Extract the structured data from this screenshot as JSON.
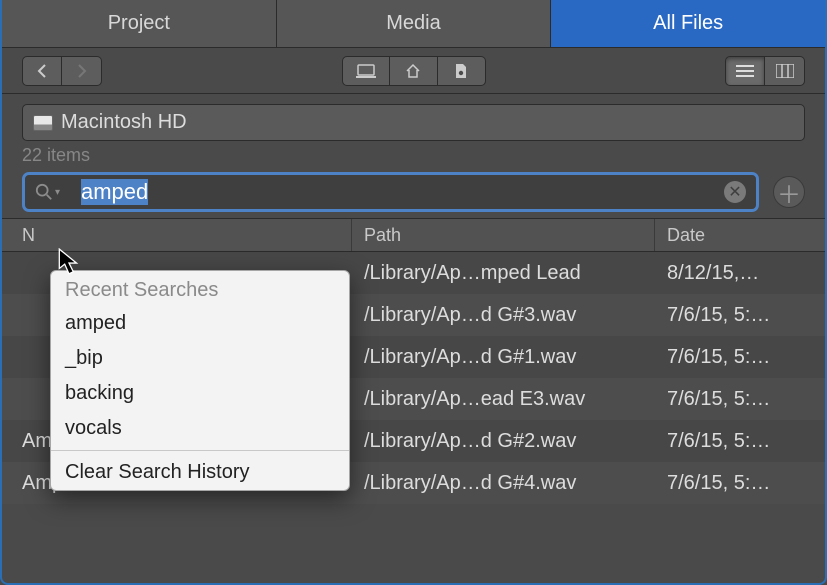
{
  "tabs": {
    "project": "Project",
    "media": "Media",
    "allfiles": "All Files",
    "active": "allfiles"
  },
  "location": {
    "volume": "Macintosh HD"
  },
  "count_label": "22 items",
  "search": {
    "value": "amped",
    "placeholder": ""
  },
  "columns": {
    "name": "N",
    "path": "Path",
    "date": "Date"
  },
  "rows": [
    {
      "name": "",
      "path": "/Library/Ap…mped Lead",
      "date": "8/12/15,…"
    },
    {
      "name": "",
      "path": "/Library/Ap…d G#3.wav",
      "date": "7/6/15, 5:…"
    },
    {
      "name": "",
      "path": "/Library/Ap…d G#1.wav",
      "date": "7/6/15, 5:…"
    },
    {
      "name": "",
      "path": "/Library/Ap…ead E3.wav",
      "date": "7/6/15, 5:…"
    },
    {
      "name": "Amped Lead G#2.wav",
      "path": "/Library/Ap…d G#2.wav",
      "date": "7/6/15, 5:…"
    },
    {
      "name": "Amped Lead G#4.wav",
      "path": "/Library/Ap…d G#4.wav",
      "date": "7/6/15, 5:…"
    }
  ],
  "popup": {
    "header": "Recent Searches",
    "items": [
      "amped",
      "_bip",
      "backing",
      "vocals"
    ],
    "clear": "Clear Search History"
  }
}
